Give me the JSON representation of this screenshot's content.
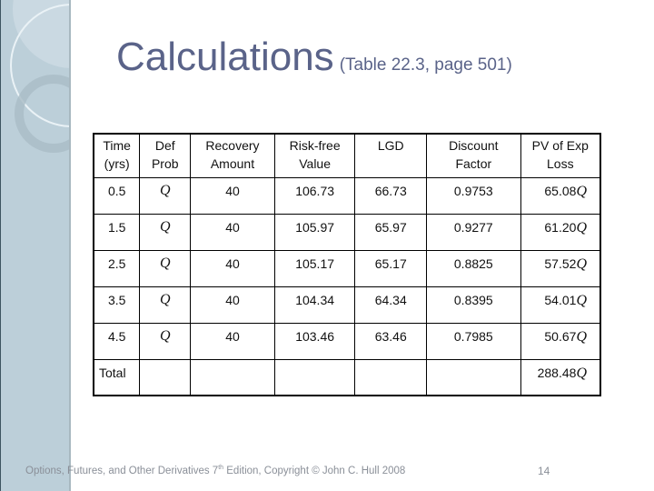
{
  "title": {
    "main": "Calculations",
    "sub": "(Table 22.3, page 501)"
  },
  "colors": {
    "title": "#5a6389",
    "sidebar": "#bccfd9",
    "footer_text": "#8a8f98"
  },
  "table": {
    "headers": [
      {
        "line1": "Time",
        "line2": "(yrs)"
      },
      {
        "line1": "Def",
        "line2": "Prob"
      },
      {
        "line1": "Recovery",
        "line2": "Amount"
      },
      {
        "line1": "Risk-free",
        "line2": "Value"
      },
      {
        "line1": "LGD",
        "line2": ""
      },
      {
        "line1": "Discount",
        "line2": "Factor"
      },
      {
        "line1": "PV of Exp",
        "line2": "Loss"
      }
    ],
    "rows": [
      {
        "time": "0.5",
        "def_prob": "Q",
        "recovery": "40",
        "risk_free": "106.73",
        "lgd": "66.73",
        "discount": "0.9753",
        "pv_num": "65.08",
        "pv_sym": "Q"
      },
      {
        "time": "1.5",
        "def_prob": "Q",
        "recovery": "40",
        "risk_free": "105.97",
        "lgd": "65.97",
        "discount": "0.9277",
        "pv_num": "61.20",
        "pv_sym": "Q"
      },
      {
        "time": "2.5",
        "def_prob": "Q",
        "recovery": "40",
        "risk_free": "105.17",
        "lgd": "65.17",
        "discount": "0.8825",
        "pv_num": "57.52",
        "pv_sym": "Q"
      },
      {
        "time": "3.5",
        "def_prob": "Q",
        "recovery": "40",
        "risk_free": "104.34",
        "lgd": "64.34",
        "discount": "0.8395",
        "pv_num": "54.01",
        "pv_sym": "Q"
      },
      {
        "time": "4.5",
        "def_prob": "Q",
        "recovery": "40",
        "risk_free": "103.46",
        "lgd": "63.46",
        "discount": "0.7985",
        "pv_num": "50.67",
        "pv_sym": "Q"
      }
    ],
    "total": {
      "label": "Total",
      "pv_num": "288.48",
      "pv_sym": "Q"
    }
  },
  "footer": {
    "text_before_sup": "Options, Futures, and Other Derivatives 7",
    "sup": "th",
    "text_after_sup": " Edition, Copyright © John C. Hull 2008",
    "page_number": "14"
  }
}
